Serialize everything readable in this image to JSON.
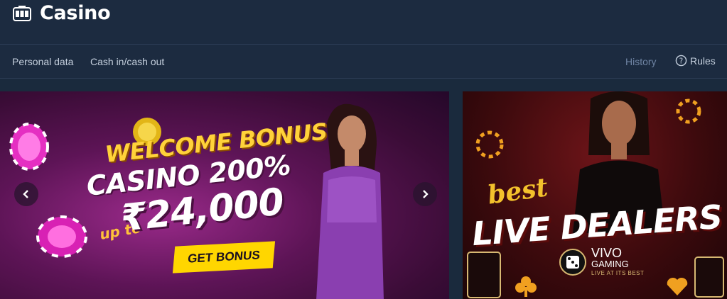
{
  "header": {
    "title": "Casino",
    "icon": "slot-machine-icon"
  },
  "nav": {
    "personal_data": "Personal data",
    "cash": "Cash in/cash out",
    "history": "History",
    "rules": "Rules"
  },
  "banners": {
    "main": {
      "line1": "WELCOME BONUS",
      "line2": "CASINO 200%",
      "upto": "up to",
      "amount": "₹24,000",
      "button": "GET BONUS"
    },
    "side": {
      "best": "best",
      "title": "LIVE DEALERS",
      "brand": "VIVO",
      "brand_sub": "GAMING",
      "tagline": "LIVE AT ITS BEST"
    }
  },
  "colors": {
    "bg": "#1c2b40",
    "accent_yellow": "#ffd600",
    "muted": "#6f84a3"
  }
}
